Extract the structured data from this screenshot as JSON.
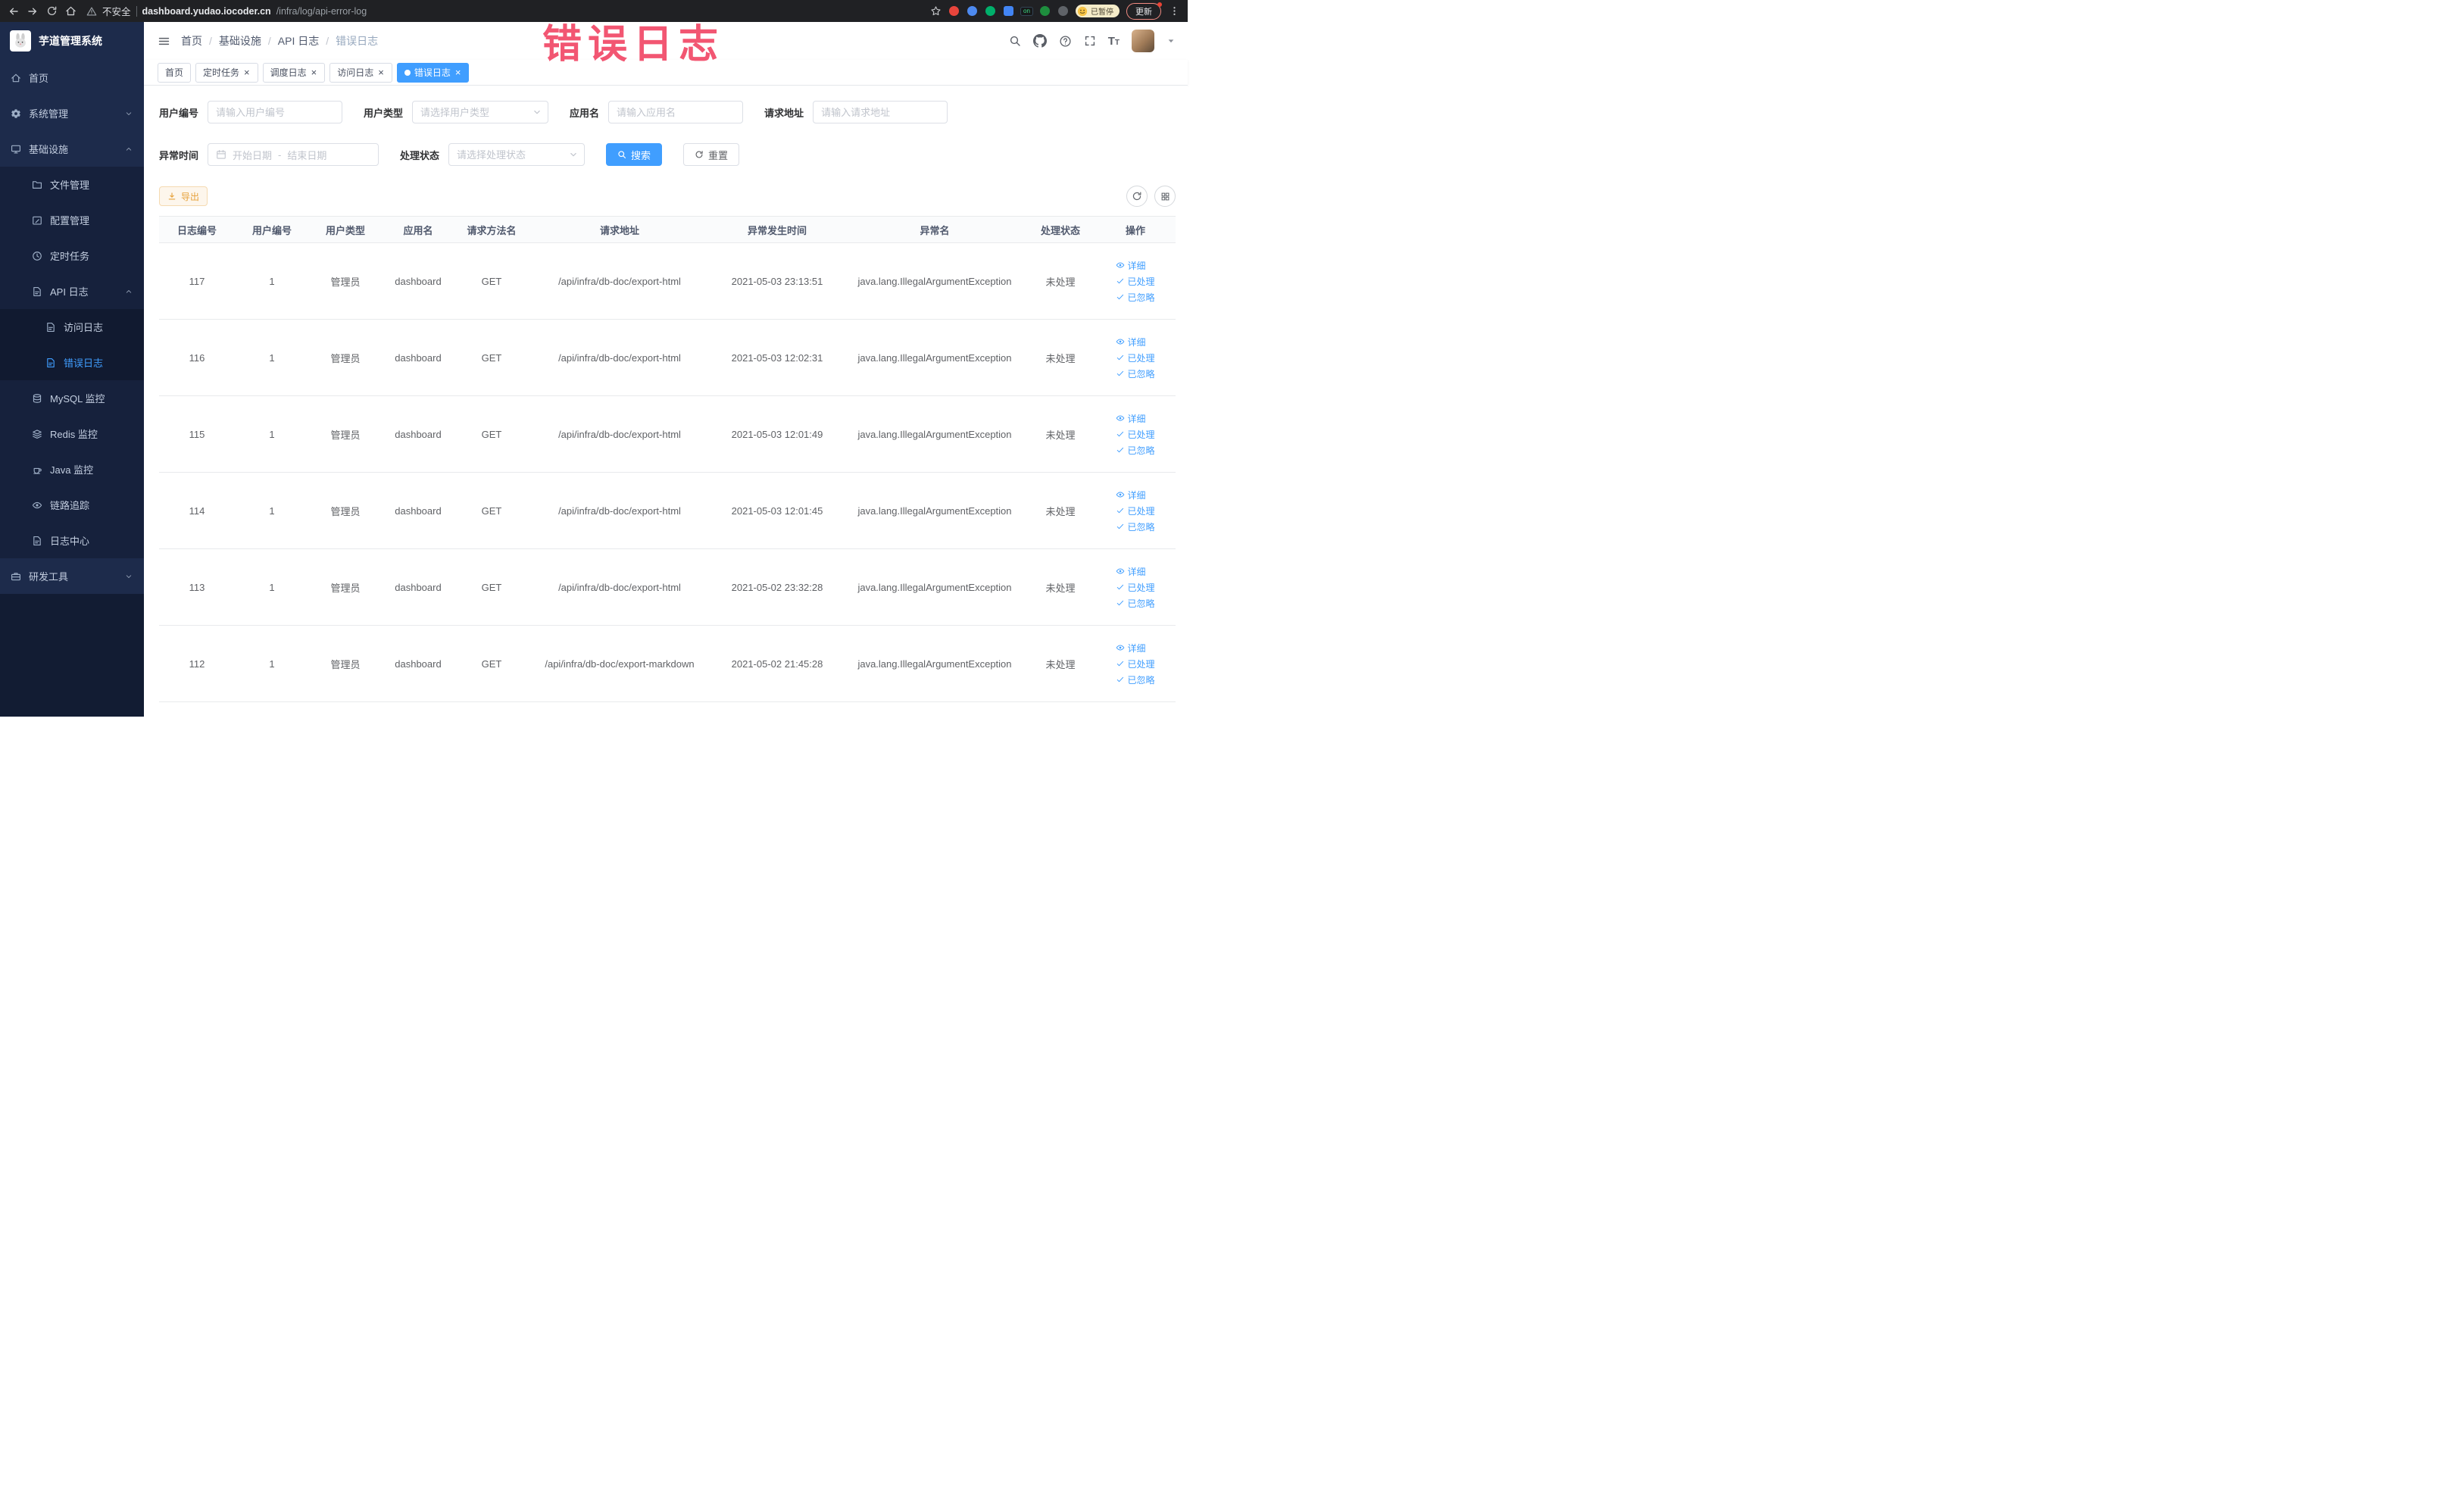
{
  "annotation": {
    "text": "错误日志"
  },
  "browser": {
    "security_label": "不安全",
    "url_domain": "dashboard.yudao.iocoder.cn",
    "url_path": "/infra/log/api-error-log",
    "ext_on_label": "on",
    "paused_badge": "已暂停",
    "update_label": "更新"
  },
  "icons": {
    "close": "×"
  },
  "sidebar": {
    "logo_title": "芋道管理系统",
    "items": [
      {
        "name": "home",
        "label": "首页",
        "icon": "home-icon",
        "depth": 0
      },
      {
        "name": "system-management",
        "label": "系统管理",
        "icon": "gear-icon",
        "depth": 0,
        "chevron": "down"
      },
      {
        "name": "infrastructure",
        "label": "基础设施",
        "icon": "monitor-icon",
        "depth": 0,
        "chevron": "up"
      },
      {
        "name": "file-management",
        "label": "文件管理",
        "icon": "folder-icon",
        "depth": 1
      },
      {
        "name": "config-management",
        "label": "配置管理",
        "icon": "edit-square-icon",
        "depth": 1
      },
      {
        "name": "scheduled-tasks",
        "label": "定时任务",
        "icon": "clock-icon",
        "depth": 1
      },
      {
        "name": "api-logs",
        "label": "API 日志",
        "icon": "doc-edit-icon",
        "depth": 1,
        "chevron": "up"
      },
      {
        "name": "access-logs",
        "label": "访问日志",
        "icon": "doc-edit-icon",
        "depth": 2
      },
      {
        "name": "error-logs",
        "label": "错误日志",
        "icon": "doc-edit-icon",
        "depth": 2,
        "active": true
      },
      {
        "name": "mysql-monitor",
        "label": "MySQL 监控",
        "icon": "database-icon",
        "depth": 1
      },
      {
        "name": "redis-monitor",
        "label": "Redis 监控",
        "icon": "layers-icon",
        "depth": 1
      },
      {
        "name": "java-monitor",
        "label": "Java 监控",
        "icon": "coffee-icon",
        "depth": 1
      },
      {
        "name": "trace",
        "label": "链路追踪",
        "icon": "eye-icon",
        "depth": 1
      },
      {
        "name": "log-center",
        "label": "日志中心",
        "icon": "doc-edit-icon",
        "depth": 1
      },
      {
        "name": "dev-tools",
        "label": "研发工具",
        "icon": "toolbox-icon",
        "depth": 0,
        "chevron": "down"
      }
    ]
  },
  "header": {
    "breadcrumb": [
      "首页",
      "基础设施",
      "API 日志",
      "错误日志"
    ],
    "separator": "/"
  },
  "tags_view": [
    {
      "name": "home",
      "label": "首页",
      "closable": false,
      "active": false
    },
    {
      "name": "job",
      "label": "定时任务",
      "closable": true,
      "active": false
    },
    {
      "name": "job-log",
      "label": "调度日志",
      "closable": true,
      "active": false
    },
    {
      "name": "api-access-log",
      "label": "访问日志",
      "closable": true,
      "active": false
    },
    {
      "name": "api-error-log",
      "label": "错误日志",
      "closable": true,
      "active": true
    }
  ],
  "filters": {
    "user_id": {
      "label": "用户编号",
      "placeholder": "请输入用户编号"
    },
    "user_type": {
      "label": "用户类型",
      "placeholder": "请选择用户类型"
    },
    "app_name": {
      "label": "应用名",
      "placeholder": "请输入应用名"
    },
    "request_url": {
      "label": "请求地址",
      "placeholder": "请输入请求地址"
    },
    "exception_time": {
      "label": "异常时间",
      "start_placeholder": "开始日期",
      "separator": "-",
      "end_placeholder": "结束日期"
    },
    "process_status": {
      "label": "处理状态",
      "placeholder": "请选择处理状态"
    },
    "search_label": "搜索",
    "reset_label": "重置"
  },
  "toolbar": {
    "export_label": "导出"
  },
  "table": {
    "columns": [
      "日志编号",
      "用户编号",
      "用户类型",
      "应用名",
      "请求方法名",
      "请求地址",
      "异常发生时间",
      "异常名",
      "处理状态",
      "操作"
    ],
    "rows": [
      [
        "117",
        "1",
        "管理员",
        "dashboard",
        "GET",
        "/api/infra/db-doc/export-html",
        "2021-05-03 23:13:51",
        "java.lang.IllegalArgumentException",
        "未处理"
      ],
      [
        "116",
        "1",
        "管理员",
        "dashboard",
        "GET",
        "/api/infra/db-doc/export-html",
        "2021-05-03 12:02:31",
        "java.lang.IllegalArgumentException",
        "未处理"
      ],
      [
        "115",
        "1",
        "管理员",
        "dashboard",
        "GET",
        "/api/infra/db-doc/export-html",
        "2021-05-03 12:01:49",
        "java.lang.IllegalArgumentException",
        "未处理"
      ],
      [
        "114",
        "1",
        "管理员",
        "dashboard",
        "GET",
        "/api/infra/db-doc/export-html",
        "2021-05-03 12:01:45",
        "java.lang.IllegalArgumentException",
        "未处理"
      ],
      [
        "113",
        "1",
        "管理员",
        "dashboard",
        "GET",
        "/api/infra/db-doc/export-html",
        "2021-05-02 23:32:28",
        "java.lang.IllegalArgumentException",
        "未处理"
      ],
      [
        "112",
        "1",
        "管理员",
        "dashboard",
        "GET",
        "/api/infra/db-doc/export-markdown",
        "2021-05-02 21:45:28",
        "java.lang.IllegalArgumentException",
        "未处理"
      ]
    ],
    "row_actions": [
      {
        "name": "detail",
        "label": "详细",
        "icon": "eye-icon"
      },
      {
        "name": "processed",
        "label": "已处理",
        "icon": "check-icon"
      },
      {
        "name": "ignored",
        "label": "已忽略",
        "icon": "check-icon"
      }
    ]
  }
}
